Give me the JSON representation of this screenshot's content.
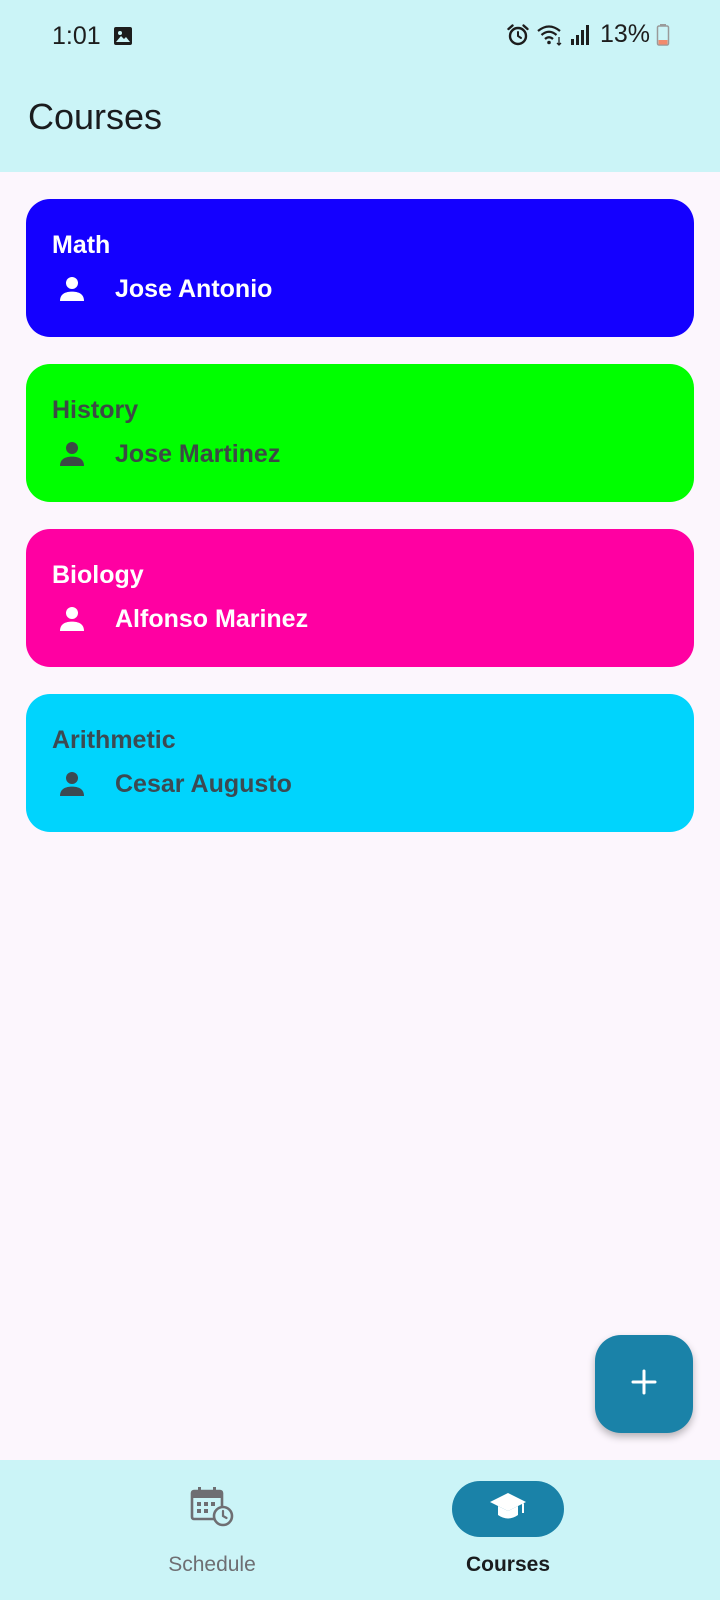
{
  "status_bar": {
    "time": "1:01",
    "battery": "13%",
    "icons": [
      "gallery-icon",
      "alarm-icon",
      "wifi-icon",
      "signal-icon",
      "battery-icon"
    ]
  },
  "app_bar": {
    "title": "Courses"
  },
  "courses": [
    {
      "name": "Math",
      "teacher": "Jose Antonio",
      "color": "#1400ff",
      "text_color": "#ffffff"
    },
    {
      "name": "History",
      "teacher": "Jose Martinez",
      "color": "#00ff00",
      "text_color": "#3c4a45"
    },
    {
      "name": "Biology",
      "teacher": "Alfonso Marinez",
      "color": "#ff00a2",
      "text_color": "#ffffff"
    },
    {
      "name": "Arithmetic",
      "teacher": "Cesar Augusto",
      "color": "#00d4fd",
      "text_color": "#3c4a52"
    }
  ],
  "fab": {
    "icon": "plus-icon"
  },
  "bottom_nav": {
    "items": [
      {
        "label": "Schedule",
        "icon": "calendar-clock-icon",
        "active": false
      },
      {
        "label": "Courses",
        "icon": "graduation-cap-icon",
        "active": true
      }
    ]
  },
  "colors": {
    "header_bg": "#cbf4f7",
    "page_bg": "#fcf6fd",
    "accent": "#1a82a8"
  }
}
